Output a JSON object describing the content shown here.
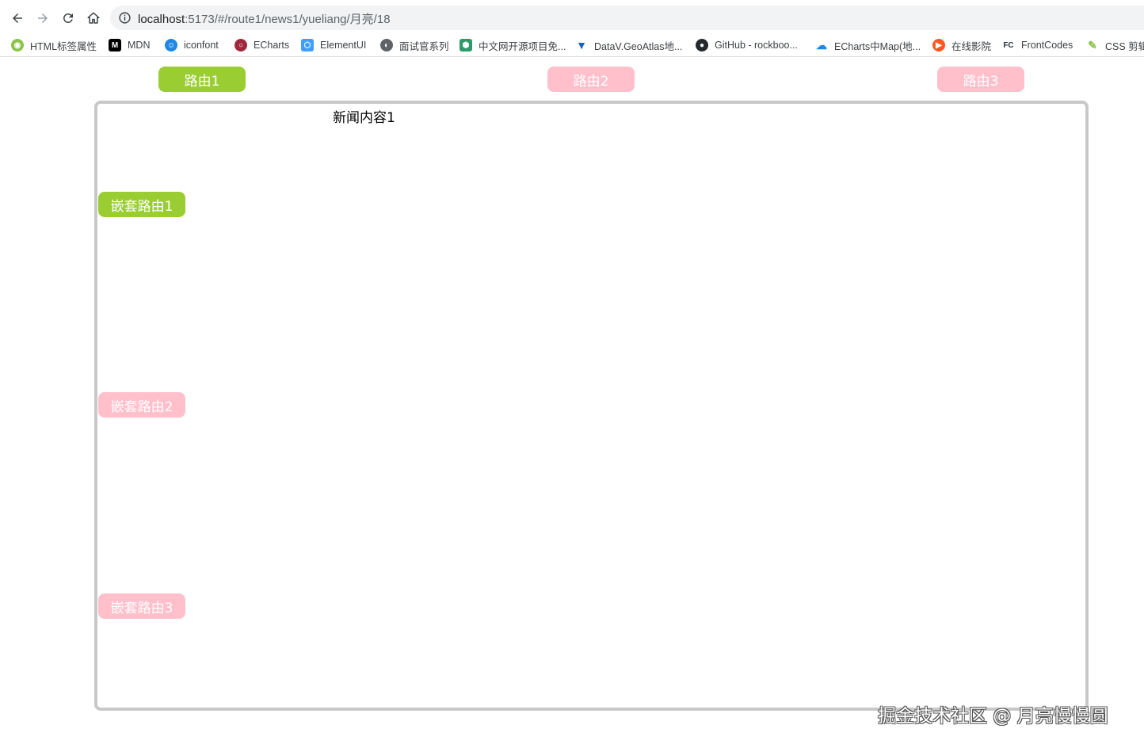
{
  "browser": {
    "url_host": "localhost",
    "url_path": ":5173/#/route1/news1/yueliang/月亮/18",
    "bookmarks": [
      {
        "label": "HTML标签属性",
        "icon": "html-icon",
        "color": "#8bc34a"
      },
      {
        "label": "MDN",
        "icon": "mdn-icon",
        "color": "#000000"
      },
      {
        "label": "iconfont",
        "icon": "iconfont-icon",
        "color": "#1e88e5"
      },
      {
        "label": "ECharts",
        "icon": "echarts-icon",
        "color": "#a0283c"
      },
      {
        "label": "ElementUI",
        "icon": "elementui-icon",
        "color": "#409eff"
      },
      {
        "label": "面试官系列",
        "icon": "globe-icon",
        "color": "#5f6368"
      },
      {
        "label": "中文网开源项目免...",
        "icon": "shield-icon",
        "color": "#2e9a6a"
      },
      {
        "label": "DataV.GeoAtlas地...",
        "icon": "datav-icon",
        "color": "#1565c0"
      },
      {
        "label": "GitHub - rockboo...",
        "icon": "github-icon",
        "color": "#24292e"
      },
      {
        "label": "ECharts中Map(地...",
        "icon": "cloud-icon",
        "color": "#1e88e5"
      },
      {
        "label": "在线影院",
        "icon": "play-icon",
        "color": "#ff5722"
      },
      {
        "label": "FrontCodes",
        "icon": "fc-icon",
        "color": "#263238"
      },
      {
        "label": "CSS 剪辑",
        "icon": "css-icon",
        "color": "#8bc34a"
      }
    ]
  },
  "routes": [
    {
      "label": "路由1",
      "active": true
    },
    {
      "label": "路由2",
      "active": false
    },
    {
      "label": "路由3",
      "active": false
    }
  ],
  "news": {
    "title": "新闻内容1"
  },
  "nested_routes": [
    {
      "label": "嵌套路由1",
      "active": true
    },
    {
      "label": "嵌套路由2",
      "active": false
    },
    {
      "label": "嵌套路由3",
      "active": false
    }
  ],
  "watermark": "掘金技术社区 @ 月亮慢慢圆",
  "colors": {
    "active": "#9acd32",
    "inactive": "#ffc0cb",
    "border": "#c8c8c8"
  }
}
